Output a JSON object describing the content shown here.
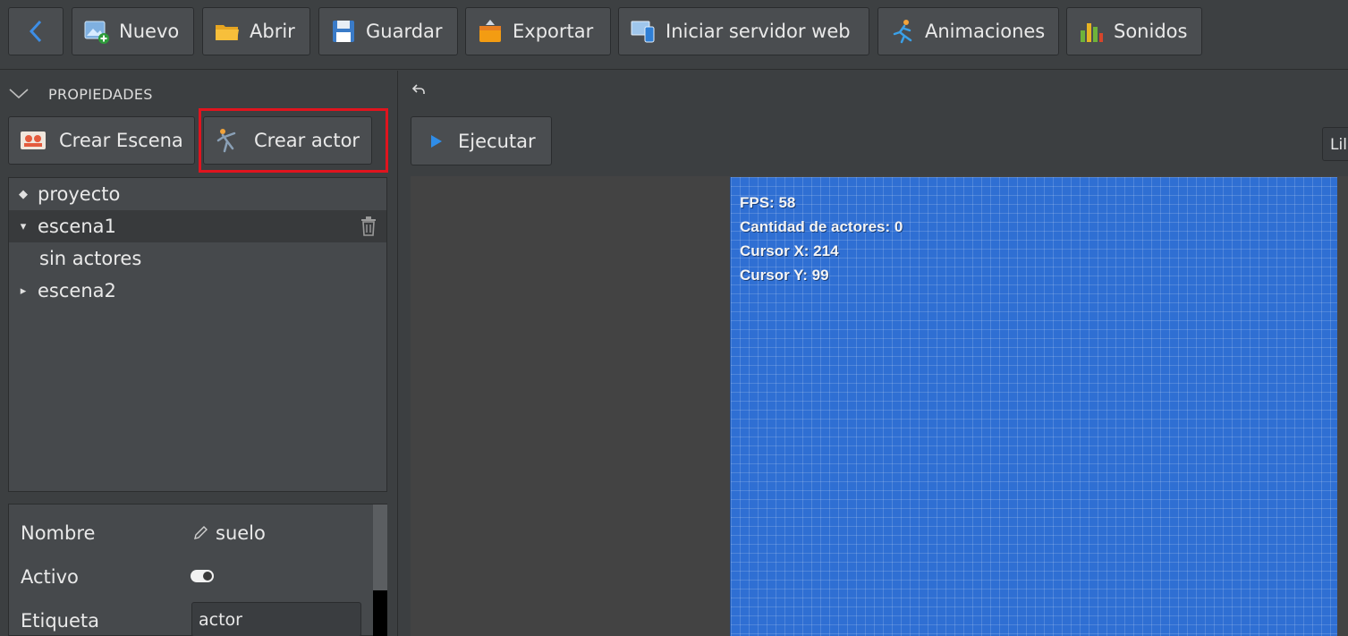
{
  "toolbar": {
    "back_icon": "chevron-left-icon",
    "buttons": [
      {
        "label": "Nuevo",
        "icon": "new-image-icon"
      },
      {
        "label": "Abrir",
        "icon": "folder-icon"
      },
      {
        "label": "Guardar",
        "icon": "floppy-disk-icon"
      },
      {
        "label": "Exportar",
        "icon": "export-box-icon"
      },
      {
        "label": "Iniciar servidor web",
        "icon": "devices-icon"
      },
      {
        "label": "Animaciones",
        "icon": "running-figure-icon"
      },
      {
        "label": "Sonidos",
        "icon": "equalizer-icon"
      }
    ]
  },
  "left_panel": {
    "section_title": "PROPIEDADES",
    "create_scene_label": "Crear Escena",
    "create_actor_label": "Crear actor",
    "tree": {
      "root": "proyecto",
      "scenes": [
        {
          "name": "escena1",
          "expanded": true,
          "selected": true,
          "children_text": "sin actores"
        },
        {
          "name": "escena2",
          "expanded": false,
          "selected": false
        }
      ]
    },
    "properties": {
      "name_label": "Nombre",
      "name_value": "suelo",
      "active_label": "Activo",
      "active_value": true,
      "tag_label": "Etiqueta",
      "tag_value": "actor"
    }
  },
  "main": {
    "run_label": "Ejecutar",
    "partial_button_label": "Lil",
    "hud": {
      "fps": "FPS: 58",
      "actors": "Cantidad de actores: 0",
      "cursor_x": "Cursor X: 214",
      "cursor_y": "Cursor Y: 99"
    }
  },
  "colors": {
    "highlight": "#e0141e",
    "canvas": "#2f6fd3",
    "panel": "#46494c"
  }
}
